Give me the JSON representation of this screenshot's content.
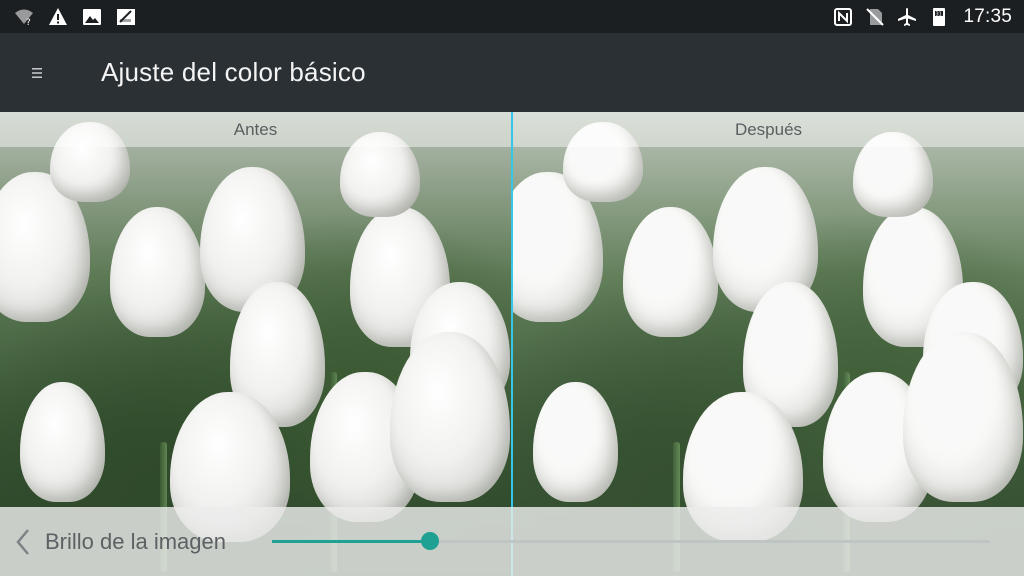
{
  "status_bar": {
    "left_icons": [
      "wifi-question-icon",
      "warning-icon",
      "image-icon",
      "sim-card-icon"
    ],
    "right_icons": [
      "nfc-icon",
      "no-sim-icon",
      "airplane-icon",
      "calendar-icon"
    ],
    "time": "17:35"
  },
  "toolbar": {
    "title": "Ajuste del color básico",
    "menu_icon": "menu-icon"
  },
  "compare": {
    "before_label": "Antes",
    "after_label": "Después",
    "divider_color": "#35c6e8"
  },
  "control": {
    "label": "Brillo de la imagen",
    "back_icon": "chevron-left-icon",
    "brightness_fraction": 0.22,
    "accent_color": "#1ea092"
  }
}
